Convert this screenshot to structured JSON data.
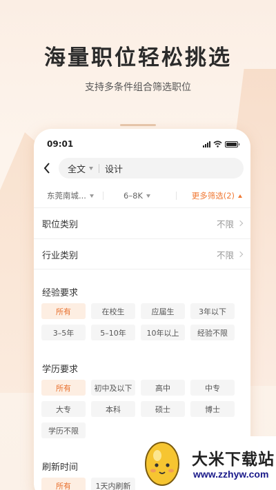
{
  "promo": {
    "headline": "海量职位轻松挑选",
    "subline": "支持多条件组合筛选职位"
  },
  "status_bar": {
    "time": "09:01"
  },
  "search": {
    "type_label": "全文",
    "query": "设计"
  },
  "filters": {
    "location": "东莞南城...",
    "salary": "6–8K",
    "more": "更多筛选(2)"
  },
  "rows": [
    {
      "label": "职位类别",
      "value": "不限"
    },
    {
      "label": "行业类别",
      "value": "不限"
    }
  ],
  "experience": {
    "title": "经验要求",
    "options": [
      "所有",
      "在校生",
      "应届生",
      "3年以下",
      "3–5年",
      "5–10年",
      "10年以上",
      "经验不限"
    ],
    "selected": "所有"
  },
  "education": {
    "title": "学历要求",
    "options": [
      "所有",
      "初中及以下",
      "高中",
      "中专",
      "大专",
      "本科",
      "硕士",
      "博士",
      "学历不限"
    ],
    "selected": "所有"
  },
  "refresh": {
    "title": "刷新时间",
    "options": [
      "所有",
      "1天内刷新"
    ],
    "selected": "所有"
  },
  "watermark": {
    "title": "大米下载站",
    "url": "www.zzhyw.com"
  },
  "colors": {
    "accent": "#f07a36",
    "selected_bg": "#fdeee2"
  }
}
